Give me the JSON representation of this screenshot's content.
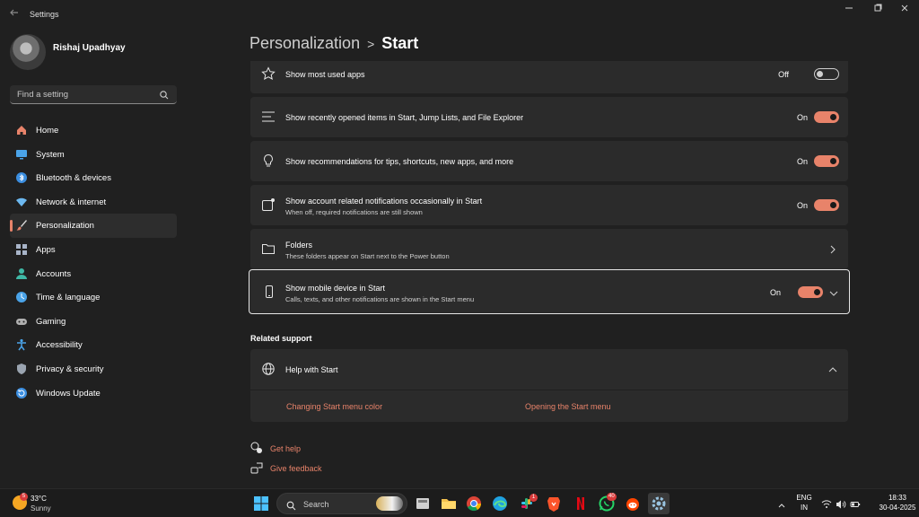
{
  "window": {
    "title": "Settings",
    "back_icon": "back-arrow-icon",
    "controls": [
      "minimize-icon",
      "maximize-icon",
      "close-icon"
    ]
  },
  "user": {
    "name": "Rishaj Upadhyay"
  },
  "search": {
    "placeholder": "Find a setting"
  },
  "sidebar": {
    "items": [
      {
        "label": "Home",
        "icon": "home-icon",
        "color": "#e8836a"
      },
      {
        "label": "System",
        "icon": "system-icon",
        "color": "#4aa3e8"
      },
      {
        "label": "Bluetooth & devices",
        "icon": "bluetooth-icon",
        "color": "#3b8ee0"
      },
      {
        "label": "Network & internet",
        "icon": "wifi-icon",
        "color": "#6cb8f0"
      },
      {
        "label": "Personalization",
        "icon": "brush-icon",
        "color": "#e8836a",
        "active": true
      },
      {
        "label": "Apps",
        "icon": "apps-icon",
        "color": "#a8b4c8"
      },
      {
        "label": "Accounts",
        "icon": "accounts-icon",
        "color": "#3fb8a5"
      },
      {
        "label": "Time & language",
        "icon": "globe-clock-icon",
        "color": "#4aa3e8"
      },
      {
        "label": "Gaming",
        "icon": "gamepad-icon",
        "color": "#b0b0b0"
      },
      {
        "label": "Accessibility",
        "icon": "accessibility-icon",
        "color": "#4aa3e8"
      },
      {
        "label": "Privacy & security",
        "icon": "shield-icon",
        "color": "#9aa4b0"
      },
      {
        "label": "Windows Update",
        "icon": "update-icon",
        "color": "#3b8ee0"
      }
    ]
  },
  "breadcrumb": {
    "parent": "Personalization",
    "separator": ">",
    "current": "Start"
  },
  "settings": [
    {
      "title": "Show most used apps",
      "icon": "star-icon",
      "state": "Off"
    },
    {
      "title": "Show recently opened items in Start, Jump Lists, and File Explorer",
      "icon": "list-icon",
      "state": "On"
    },
    {
      "title": "Show recommendations for tips, shortcuts, new apps, and more",
      "icon": "lightbulb-icon",
      "state": "On"
    },
    {
      "title": "Show account related notifications occasionally in Start",
      "desc": "When off, required notifications are still shown",
      "icon": "notification-icon",
      "state": "On"
    },
    {
      "title": "Folders",
      "desc": "These folders appear on Start next to the Power button",
      "icon": "folder-icon"
    },
    {
      "title": "Show mobile device in Start",
      "desc": "Calls, texts, and other notifications are shown in the Start menu",
      "icon": "phone-icon",
      "state": "On"
    }
  ],
  "related_support": {
    "heading": "Related support",
    "help_title": "Help with Start",
    "links": [
      "Changing Start menu color",
      "Opening the Start menu"
    ]
  },
  "footer_links": {
    "get_help": "Get help",
    "give_feedback": "Give feedback"
  },
  "taskbar": {
    "weather_temp": "33°C",
    "weather_condition": "Sunny",
    "weather_badge": "5",
    "search_label": "Search",
    "apps": [
      "file-manager-icon",
      "explorer-folder-icon",
      "chrome-icon",
      "edge-icon",
      "slack-icon",
      "brave-icon",
      "netflix-icon",
      "whatsapp-icon",
      "reddit-icon",
      "settings-gear-icon"
    ],
    "slack_badge": "1",
    "whatsapp_badge": "40",
    "lang_top": "ENG",
    "lang_bottom": "IN",
    "time": "18:33",
    "date": "30-04-2025"
  },
  "colors": {
    "accent": "#e8836a",
    "background": "#202020",
    "card": "#2b2b2b"
  }
}
